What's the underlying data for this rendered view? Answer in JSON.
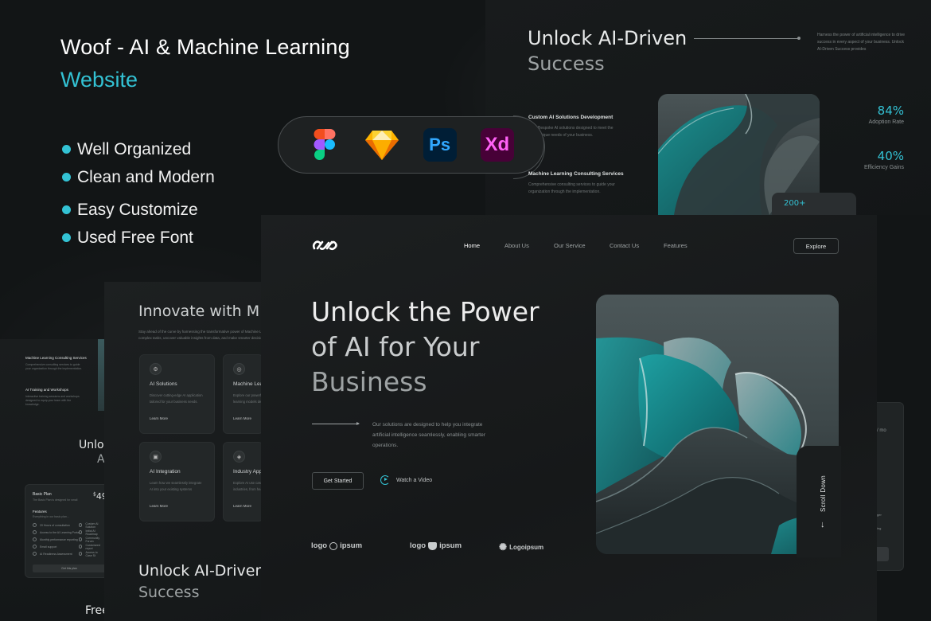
{
  "promo": {
    "title": "Woof - AI & Machine Learning",
    "subtitle": "Website",
    "accent_color": "#33c2d4",
    "features": [
      "Well Organized",
      "Clean and Modern",
      "Easy Customize",
      "Used Free Font"
    ],
    "tools": [
      {
        "name": "Figma",
        "icon": "figma-icon"
      },
      {
        "name": "Sketch",
        "icon": "sketch-icon"
      },
      {
        "name": "Ps",
        "icon": "photoshop-icon"
      },
      {
        "name": "Xd",
        "icon": "adobe-xd-icon"
      }
    ]
  },
  "top_right_preview": {
    "heading_line1": "Unlock AI-Driven",
    "heading_line2": "Success",
    "paragraph": "Harness the power of artificial intelligence to drive success in every aspect of your business. Unlock AI-Driven Success provides",
    "services": [
      {
        "title": "Custom AI Solutions Development",
        "desc": "Bespoke AI solutions designed to meet the unique needs of your business."
      },
      {
        "title": "Machine Learning Consulting Services",
        "desc": "Comprehensive consulting services to guide your organization through the implementation."
      }
    ],
    "stats": [
      {
        "value": "84%",
        "label": "Adoption Rate"
      },
      {
        "value": "40%",
        "label": "Efficiency Gains"
      }
    ],
    "projects_value": "200+"
  },
  "far_left_preview": {
    "services": [
      {
        "title": "Machine Learning Consulting Services",
        "desc": "Comprehensive consulting services to guide your organization through the implementation."
      },
      {
        "title": "AI Training and Workshops",
        "desc": "Interactive training sessions and workshops designed to equip your team with the knowledge."
      }
    ],
    "unlock_line1": "Unloc",
    "unlock_line2": "A",
    "plan": {
      "name": "Basic Plan",
      "desc": "The Basic Plan is designed for small",
      "price": "49",
      "currency": "$",
      "features_title": "Features",
      "features_sub": "Everything in our basic plan...",
      "features_col1": [
        "20 Hours of consultation",
        "Access to the AI Learning Portal",
        "Monthly performance reporting",
        "Email support",
        "AI Readiness Assessment"
      ],
      "features_col2": [
        "Custom AI Solution",
        "Initial AI Roadmap",
        "Community Forum",
        "Customized report",
        "Access to Case St"
      ],
      "button": "Get this plan"
    },
    "free_text": "Free"
  },
  "middle_left_preview": {
    "heading": "Innovate with M",
    "paragraph_line1": "Stay ahead of the curve by harnessing the transformative power of Machine Lear",
    "paragraph_line2": "complex tasks, uncover valuable insights from data, and make smarter decisions",
    "cards": [
      {
        "title": "AI Solutions",
        "desc1": "Discover cutting-edge AI application",
        "desc2": "tailored for your business needs.",
        "link": "Learn More",
        "icon": "chip-icon"
      },
      {
        "title": "Machine Lea",
        "desc1": "Explore our powerful",
        "desc2": "learning models de",
        "link": "Learn More",
        "icon": "brain-icon"
      },
      {
        "title": "AI Integration",
        "desc1": "Learn how we seamlessly integrate",
        "desc2": "AI into your existing systems",
        "link": "Learn More",
        "icon": "robot-icon"
      },
      {
        "title": "Industry App",
        "desc1": "Explore AI use case",
        "desc2": "industries, from hea",
        "link": "Learn More",
        "icon": "industry-icon"
      }
    ],
    "unlock_line1": "Unlock AI-Driven",
    "unlock_line2": "Success"
  },
  "hero": {
    "nav": [
      {
        "label": "Home",
        "active": true
      },
      {
        "label": "About Us",
        "active": false
      },
      {
        "label": "Our Service",
        "active": false
      },
      {
        "label": "Contact Us",
        "active": false
      },
      {
        "label": "Features",
        "active": false
      }
    ],
    "explore_label": "Explore",
    "headline_line1": "Unlock the Power",
    "headline_line2": "of AI for Your",
    "headline_line3": "Business",
    "paragraph": "Our solutions are designed to help you integrate artificial intelligence seamlessly, enabling smarter operations.",
    "get_started_label": "Get Started",
    "watch_video_label": "Watch a Video",
    "scroll_down_label": "Scroll Down",
    "scroll_arrow": "↓",
    "partners": [
      {
        "left": "logo",
        "right": "ipsum",
        "icon": "globe-icon"
      },
      {
        "left": "logo",
        "right": "ipsum",
        "icon": "bear-icon"
      },
      {
        "left": "",
        "right": "Logoipsum",
        "icon": "sun-icon"
      }
    ]
  },
  "right_preview": {
    "price_suffix": "/ mo",
    "text1": "ger",
    "text2": "ing"
  }
}
